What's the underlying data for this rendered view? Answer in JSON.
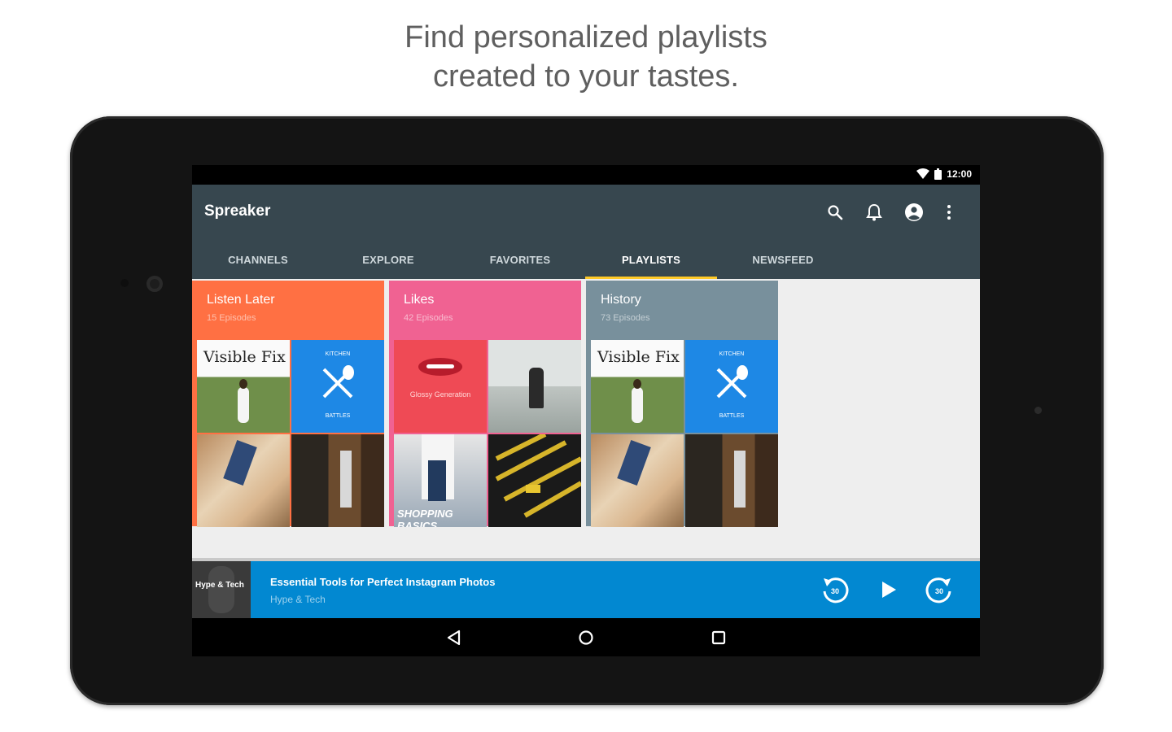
{
  "headline": {
    "line1": "Find personalized playlists",
    "line2": "created to your tastes."
  },
  "status_bar": {
    "time": "12:00",
    "icons": [
      "wifi-icon",
      "battery-icon"
    ]
  },
  "app_bar": {
    "title": "Spreaker",
    "actions": [
      "search-icon",
      "bell-icon",
      "account-icon",
      "overflow-menu-icon"
    ]
  },
  "tabs": [
    {
      "label": "CHANNELS",
      "active": false
    },
    {
      "label": "EXPLORE",
      "active": false
    },
    {
      "label": "FAVORITES",
      "active": false
    },
    {
      "label": "PLAYLISTS",
      "active": true
    },
    {
      "label": "NEWSFEED",
      "active": false
    }
  ],
  "playlists": [
    {
      "title": "Listen Later",
      "count": "15 Episodes",
      "color": "#ff7043",
      "tiles": [
        {
          "text": "Visible Fix"
        },
        {
          "top": "KITCHEN",
          "bottom": "BATTLES"
        },
        {
          "text": ""
        },
        {
          "text": ""
        }
      ]
    },
    {
      "title": "Likes",
      "count": "42 Episodes",
      "color": "#f06292",
      "tiles": [
        {
          "text": "Glossy Generation"
        },
        {
          "text": ""
        },
        {
          "text": ""
        },
        {
          "text": ""
        }
      ],
      "extra_text": "SHOPPING BASICS"
    },
    {
      "title": "History",
      "count": "73 Episodes",
      "color": "#78909c",
      "tiles": [
        {
          "text": "Visible Fix"
        },
        {
          "top": "KITCHEN",
          "bottom": "BATTLES"
        },
        {
          "text": ""
        },
        {
          "text": ""
        }
      ]
    }
  ],
  "player": {
    "thumb_label": "Hype & Tech",
    "title": "Essential Tools for Perfect Instagram Photos",
    "subtitle": "Hype & Tech",
    "rewind_label": "30",
    "forward_label": "30"
  },
  "nav": [
    "back-icon",
    "home-icon",
    "recents-icon"
  ],
  "colors": {
    "app_bar": "#37474f",
    "tab_indicator": "#ffca28",
    "player": "#0288d1"
  }
}
